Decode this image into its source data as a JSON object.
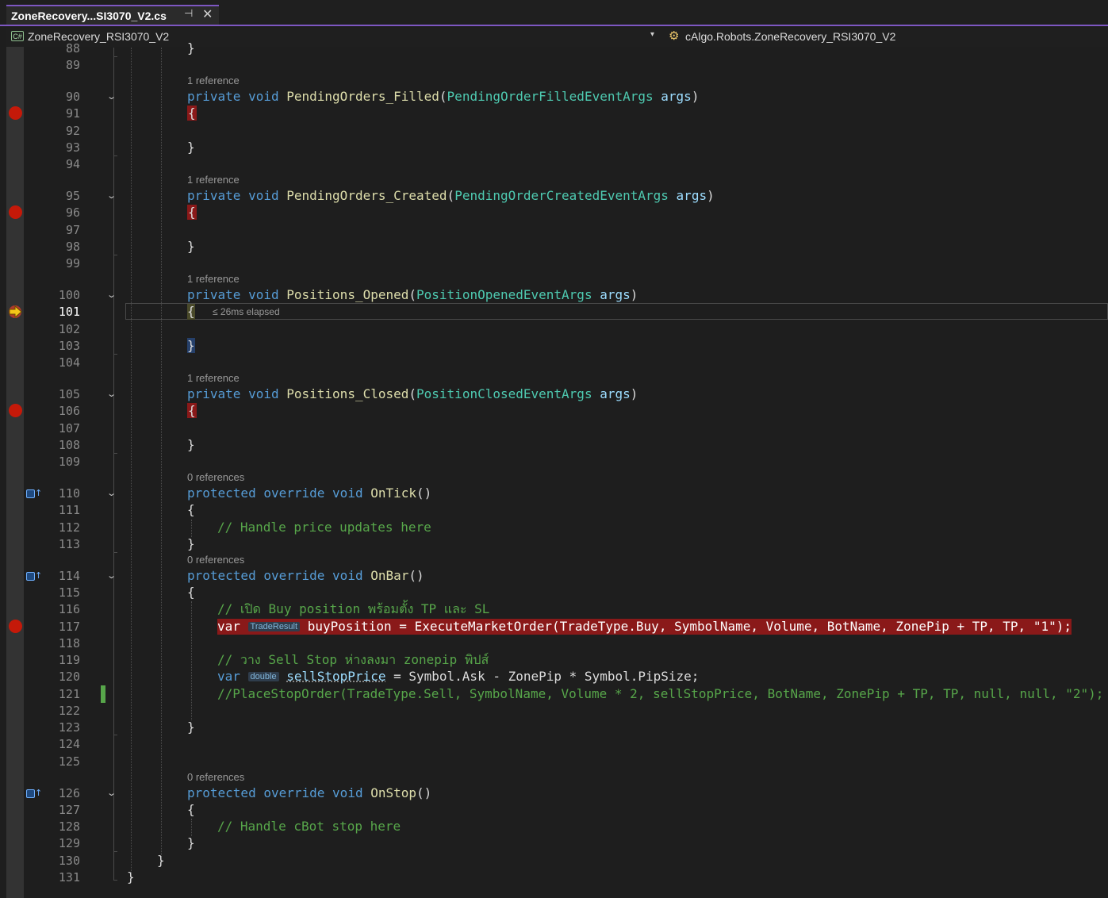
{
  "tab": {
    "title": "ZoneRecovery...SI3070_V2.cs",
    "pin_glyph": "⊣",
    "close_glyph": "✕"
  },
  "navbar": {
    "project_icon": "C#",
    "project": "ZoneRecovery_RSI3070_V2",
    "dropdown_glyph": "▾",
    "class_icon_glyph": "⚙",
    "class": "cAlgo.Robots.ZoneRecovery_RSI3070_V2"
  },
  "line_numbers": [
    "88",
    "89",
    "90",
    "91",
    "92",
    "93",
    "94",
    "95",
    "96",
    "97",
    "98",
    "99",
    "100",
    "101",
    "102",
    "103",
    "104",
    "105",
    "106",
    "107",
    "108",
    "109",
    "110",
    "111",
    "112",
    "113",
    "114",
    "115",
    "116",
    "117",
    "118",
    "119",
    "120",
    "121",
    "122",
    "123",
    "124",
    "125",
    "126",
    "127",
    "128",
    "129",
    "130",
    "131"
  ],
  "current_line": "101",
  "codelens": {
    "filled": "1 reference",
    "created": "1 reference",
    "opened": "1 reference",
    "closed": "1 reference",
    "ontick": "0 references",
    "onbar": "0 references",
    "onstop": "0 references"
  },
  "perf_tip": "≤ 26ms elapsed",
  "code": {
    "l88": "}",
    "filled": {
      "mod": "private",
      "ret": "void",
      "name": "PendingOrders_Filled",
      "ptype": "PendingOrderFilledEventArgs",
      "param": "args"
    },
    "created": {
      "mod": "private",
      "ret": "void",
      "name": "PendingOrders_Created",
      "ptype": "PendingOrderCreatedEventArgs",
      "param": "args"
    },
    "opened": {
      "mod": "private",
      "ret": "void",
      "name": "Positions_Opened",
      "ptype": "PositionOpenedEventArgs",
      "param": "args"
    },
    "closed": {
      "mod": "private",
      "ret": "void",
      "name": "Positions_Closed",
      "ptype": "PositionClosedEventArgs",
      "param": "args"
    },
    "ontick": {
      "mod": "protected",
      "ovr": "override",
      "ret": "void",
      "name": "OnTick",
      "comment": "// Handle price updates here"
    },
    "onbar": {
      "mod": "protected",
      "ovr": "override",
      "ret": "void",
      "name": "OnBar",
      "comment1": "// เปิด Buy position พร้อมตั้ง TP และ SL",
      "var_kw": "var",
      "hint1": "TradeResult",
      "line117_rest": "buyPosition = ExecuteMarketOrder(TradeType.Buy, SymbolName, Volume, BotName, ZonePip + TP, TP, \"1\");",
      "comment2": "// วาง Sell Stop ห่างลงมา zonepip พิปส์",
      "hint2": "double",
      "line120_var": "sellStopPrice",
      "line120_rest": " = Symbol.Ask - ZonePip * Symbol.PipSize;",
      "line121": "//PlaceStopOrder(TradeType.Sell, SymbolName, Volume * 2, sellStopPrice, BotName, ZonePip + TP, TP, null, null, \"2\");"
    },
    "onstop": {
      "mod": "protected",
      "ovr": "override",
      "ret": "void",
      "name": "OnStop",
      "comment": "// Handle cBot stop here"
    }
  },
  "colors": {
    "keyword": "#569cd6",
    "method": "#dcdcaa",
    "type": "#4ec9b0",
    "param": "#9cdcfe",
    "comment": "#57a64a",
    "string": "#d69d85",
    "breakpoint": "#e51400",
    "accent": "#7e57c2"
  }
}
